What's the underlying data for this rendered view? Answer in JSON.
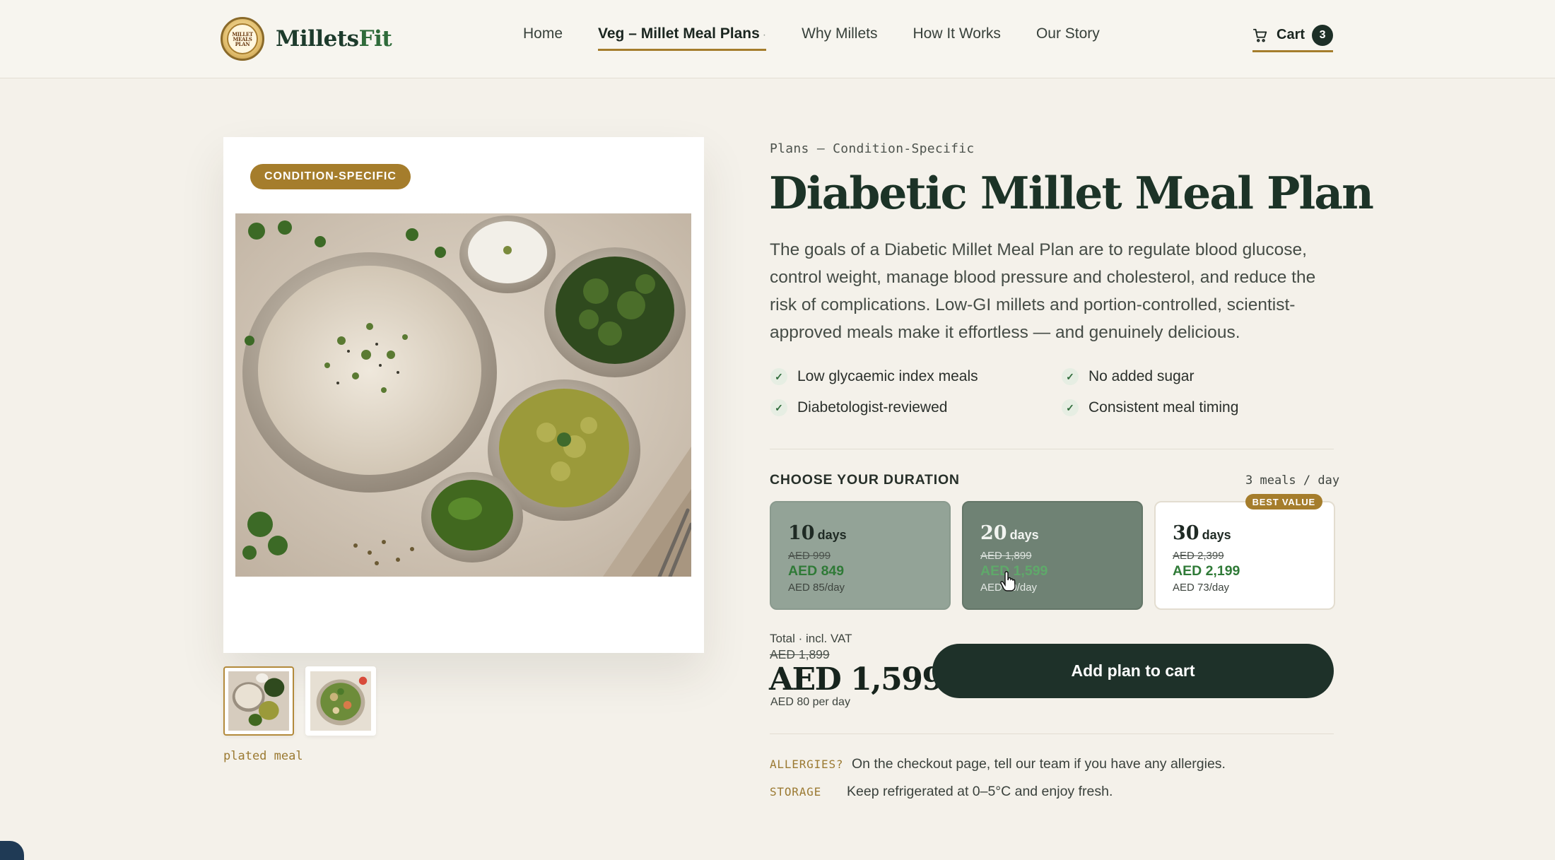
{
  "header": {
    "logo_text_a": "Millets",
    "logo_text_b": "Fit",
    "logo_badge_text": "MILLET MEALS PLAN",
    "nav": [
      {
        "label": "Home"
      },
      {
        "label": "Veg – Millet Meal Plans"
      },
      {
        "label": "Why Millets"
      },
      {
        "label": "How It Works"
      },
      {
        "label": "Our Story"
      }
    ],
    "nav_dropdown_marker": "·",
    "cart_label": "Cart",
    "cart_count": "3"
  },
  "gallery": {
    "badge": "CONDITION-SPECIFIC",
    "caption": "plated meal",
    "active_thumb": 1
  },
  "product": {
    "eyebrow": "Plans — Condition-Specific",
    "title": "Diabetic Millet Meal Plan",
    "description": "The goals of a Diabetic Millet Meal Plan are to regulate blood glucose, control weight, manage blood pressure and cholesterol, and reduce the risk of complications. Low-GI millets and portion-controlled, scientist-approved meals make it effortless — and genuinely delicious.",
    "features": [
      "Low glycaemic index meals",
      "No added sugar",
      "Diabetologist-reviewed",
      "Consistent meal timing"
    ]
  },
  "duration": {
    "label": "CHOOSE YOUR DURATION",
    "meta": "3 meals / day",
    "days_word": "days",
    "best_value": "BEST VALUE",
    "selected": "20",
    "plans": [
      {
        "days": "10",
        "old": "AED 999",
        "price": "AED 849",
        "perday": "AED 85/day"
      },
      {
        "days": "20",
        "old": "AED 1,899",
        "price": "AED 1,599",
        "perday": "AED 80/day"
      },
      {
        "days": "30",
        "old": "AED 2,399",
        "price": "AED 2,199",
        "perday": "AED 73/day"
      }
    ]
  },
  "total": {
    "label": "Total · incl. VAT",
    "old": "AED 1,899",
    "price": "AED 1,599",
    "perday": "AED 80 per day",
    "button": "Add plan to cart"
  },
  "notes": [
    {
      "key": "ALLERGIES?",
      "value": "On the checkout page, tell our team if you have any allergies."
    },
    {
      "key": "STORAGE",
      "value": "Keep refrigerated at 0–5°C and enjoy fresh."
    }
  ],
  "colors": {
    "accent_gold": "#a57d2c",
    "dark_green": "#1e3129",
    "price_green": "#2f7a37",
    "background": "#f4f1ea"
  }
}
